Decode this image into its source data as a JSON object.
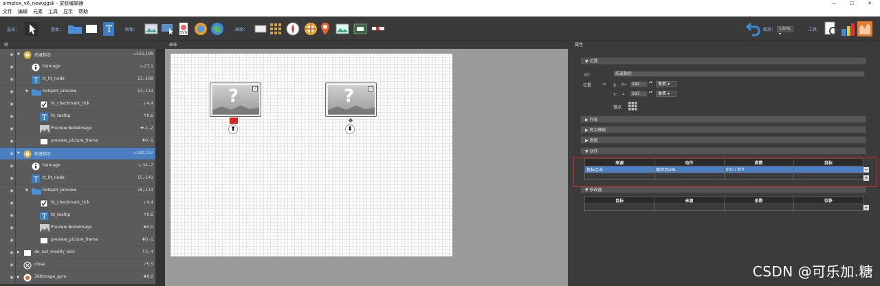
{
  "window": {
    "title": "simplex_v6_new.ggsk - 皮肤编辑器",
    "min": "—",
    "max": "☐",
    "close": "✕"
  },
  "menu": [
    "文件",
    "编辑",
    "元素",
    "工具",
    "显示",
    "帮助"
  ],
  "toolbar": {
    "select_label": "选择：",
    "basic_label": "基本：",
    "image_label": "图像：",
    "advanced_label": "高级：",
    "scale_label": "缩放：",
    "zoom_value": "100% ▾",
    "tools_label": "工具："
  },
  "panels": {
    "tree": "树",
    "canvas": "画布",
    "props": "属性"
  },
  "tree": [
    {
      "name": "后退指示",
      "value": "↘522,199",
      "level": 0,
      "icon": "gear-badge-icon",
      "expanded": true
    },
    {
      "name": "hsimage",
      "value": "↘-27,1",
      "level": 1,
      "icon": "info-icon"
    },
    {
      "name": "tt_ht_node",
      "value": "13,-168",
      "level": 1,
      "icon": "text-icon"
    },
    {
      "name": "hotspot_preview",
      "value": "13,-114",
      "level": 1,
      "icon": "folder-icon",
      "expanded": true
    },
    {
      "name": "ht_checkmark_tick",
      "value": "↙4,4",
      "level": 2,
      "icon": "checkbox-icon"
    },
    {
      "name": "ht_tooltip",
      "value": "↑0,6",
      "level": 2,
      "icon": "text-icon"
    },
    {
      "name": "Preview NodeImage",
      "value": "✚-1,-2",
      "level": 2,
      "icon": "image-icon"
    },
    {
      "name": "preview_picture_frame",
      "value": "✚0,-1",
      "level": 2,
      "icon": "rect-icon"
    },
    {
      "name": "前进指示",
      "value": "↘182,197",
      "level": 0,
      "icon": "gear-badge-icon",
      "expanded": true,
      "selected": true
    },
    {
      "name": "hsimage",
      "value": "↘-34,-2",
      "level": 1,
      "icon": "info-icon"
    },
    {
      "name": "tt_ht_node",
      "value": "15,-141",
      "level": 1,
      "icon": "text-icon"
    },
    {
      "name": "hotspot_preview",
      "value": "18,-114",
      "level": 1,
      "icon": "folder-icon",
      "expanded": true
    },
    {
      "name": "ht_checkmark_tick",
      "value": "↙4,4",
      "level": 2,
      "icon": "checkbox-icon"
    },
    {
      "name": "ht_tooltip",
      "value": "↑0,6",
      "level": 2,
      "icon": "text-icon"
    },
    {
      "name": "Preview NodeImage",
      "value": "✚0,0",
      "level": 2,
      "icon": "image-icon"
    },
    {
      "name": "preview_picture_frame",
      "value": "✚0,-1",
      "level": 2,
      "icon": "rect-icon"
    },
    {
      "name": "do_not_modify_skin",
      "value": "↑3,-4",
      "level": 0,
      "icon": "rect-icon",
      "collapsed": true
    },
    {
      "name": "close",
      "value": "↗5,5",
      "level": 0,
      "icon": "close-circle-icon"
    },
    {
      "name": "360image_gyro",
      "value": "✚0,0",
      "level": 0,
      "icon": "gyro-icon",
      "collapsed": true
    }
  ],
  "props": {
    "position_header": "位置",
    "id_label": "ID：",
    "id_value": "前进指示",
    "pos_label": "位置",
    "x_label": "X：",
    "x_value": "182",
    "y_label": "Y：",
    "y_value": "197",
    "unit": "像素",
    "anchor_label": "锚点",
    "sections": [
      "外观",
      "热点模板",
      "高级"
    ],
    "action_header": "动作",
    "action_columns": [
      "来源",
      "动作",
      "参数",
      "目标"
    ],
    "action_row": [
      "鼠标点击",
      "跳转到URL",
      "$hu / $ht",
      ""
    ],
    "modifier_header": "修改器",
    "modifier_columns": [
      "目标",
      "来源",
      "系数",
      "位移"
    ]
  },
  "watermark": "CSDN @可乐加.糖",
  "colors": {
    "selected_row": "#4a7fc1",
    "highlight_box": "#d02b2b",
    "accent_label": "#8fb4e0"
  }
}
